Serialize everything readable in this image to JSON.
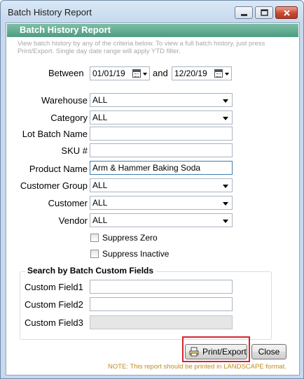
{
  "window": {
    "title": "Batch History Report"
  },
  "header": {
    "title": "Batch History Report"
  },
  "intro": "View batch history by any of the criteria below.  To view a full batch history, just press Print/Export. Single day date range will apply YTD filter.",
  "date_range": {
    "between_label": "Between",
    "from": "01/01/19",
    "and_label": "and",
    "to": "12/20/19"
  },
  "fields": {
    "warehouse": {
      "label": "Warehouse",
      "value": "ALL"
    },
    "category": {
      "label": "Category",
      "value": "ALL"
    },
    "lot_batch_name": {
      "label": "Lot Batch Name",
      "value": ""
    },
    "sku": {
      "label": "SKU #",
      "value": ""
    },
    "product_name": {
      "label": "Product Name",
      "value": "Arm & Hammer Baking Soda"
    },
    "customer_group": {
      "label": "Customer Group",
      "value": "ALL"
    },
    "customer": {
      "label": "Customer",
      "value": "ALL"
    },
    "vendor": {
      "label": "Vendor",
      "value": "ALL"
    }
  },
  "checkboxes": {
    "suppress_zero": {
      "label": "Suppress Zero",
      "checked": false
    },
    "suppress_inactive": {
      "label": "Suppress Inactive",
      "checked": false
    }
  },
  "custom_group": {
    "title": "Search by Batch Custom Fields",
    "field1": {
      "label": "Custom Field1",
      "value": ""
    },
    "field2": {
      "label": "Custom Field2",
      "value": ""
    },
    "field3": {
      "label": "Custom Field3",
      "value": ""
    }
  },
  "buttons": {
    "print_export": "Print/Export",
    "close": "Close"
  },
  "note": "NOTE:  This report should be printed in LANDSCAPE format."
}
